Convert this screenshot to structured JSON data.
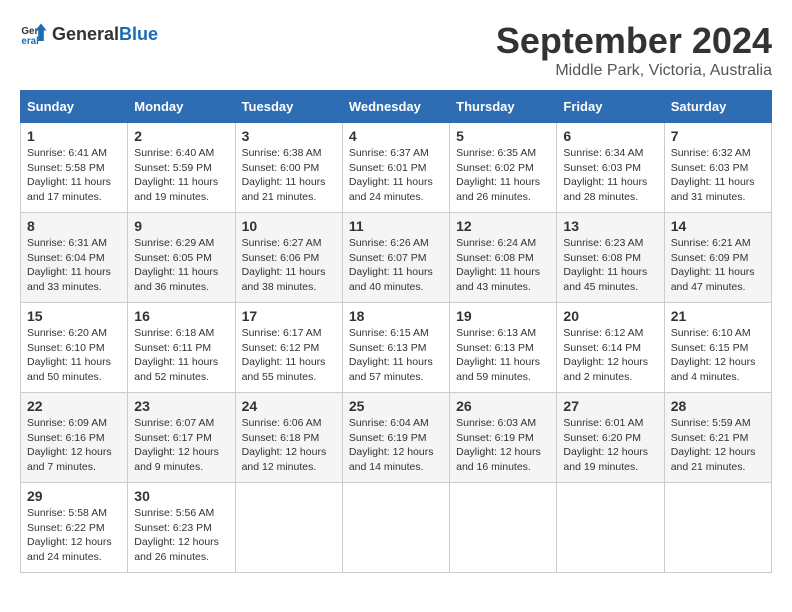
{
  "header": {
    "logo_general": "General",
    "logo_blue": "Blue",
    "title": "September 2024",
    "subtitle": "Middle Park, Victoria, Australia"
  },
  "calendar": {
    "columns": [
      "Sunday",
      "Monday",
      "Tuesday",
      "Wednesday",
      "Thursday",
      "Friday",
      "Saturday"
    ],
    "weeks": [
      [
        null,
        {
          "day": "2",
          "sunrise": "Sunrise: 6:40 AM",
          "sunset": "Sunset: 5:59 PM",
          "daylight": "Daylight: 11 hours and 19 minutes."
        },
        {
          "day": "3",
          "sunrise": "Sunrise: 6:38 AM",
          "sunset": "Sunset: 6:00 PM",
          "daylight": "Daylight: 11 hours and 21 minutes."
        },
        {
          "day": "4",
          "sunrise": "Sunrise: 6:37 AM",
          "sunset": "Sunset: 6:01 PM",
          "daylight": "Daylight: 11 hours and 24 minutes."
        },
        {
          "day": "5",
          "sunrise": "Sunrise: 6:35 AM",
          "sunset": "Sunset: 6:02 PM",
          "daylight": "Daylight: 11 hours and 26 minutes."
        },
        {
          "day": "6",
          "sunrise": "Sunrise: 6:34 AM",
          "sunset": "Sunset: 6:03 PM",
          "daylight": "Daylight: 11 hours and 28 minutes."
        },
        {
          "day": "7",
          "sunrise": "Sunrise: 6:32 AM",
          "sunset": "Sunset: 6:03 PM",
          "daylight": "Daylight: 11 hours and 31 minutes."
        }
      ],
      [
        {
          "day": "1",
          "sunrise": "Sunrise: 6:41 AM",
          "sunset": "Sunset: 5:58 PM",
          "daylight": "Daylight: 11 hours and 17 minutes."
        },
        null,
        null,
        null,
        null,
        null,
        null
      ],
      [
        {
          "day": "8",
          "sunrise": "Sunrise: 6:31 AM",
          "sunset": "Sunset: 6:04 PM",
          "daylight": "Daylight: 11 hours and 33 minutes."
        },
        {
          "day": "9",
          "sunrise": "Sunrise: 6:29 AM",
          "sunset": "Sunset: 6:05 PM",
          "daylight": "Daylight: 11 hours and 36 minutes."
        },
        {
          "day": "10",
          "sunrise": "Sunrise: 6:27 AM",
          "sunset": "Sunset: 6:06 PM",
          "daylight": "Daylight: 11 hours and 38 minutes."
        },
        {
          "day": "11",
          "sunrise": "Sunrise: 6:26 AM",
          "sunset": "Sunset: 6:07 PM",
          "daylight": "Daylight: 11 hours and 40 minutes."
        },
        {
          "day": "12",
          "sunrise": "Sunrise: 6:24 AM",
          "sunset": "Sunset: 6:08 PM",
          "daylight": "Daylight: 11 hours and 43 minutes."
        },
        {
          "day": "13",
          "sunrise": "Sunrise: 6:23 AM",
          "sunset": "Sunset: 6:08 PM",
          "daylight": "Daylight: 11 hours and 45 minutes."
        },
        {
          "day": "14",
          "sunrise": "Sunrise: 6:21 AM",
          "sunset": "Sunset: 6:09 PM",
          "daylight": "Daylight: 11 hours and 47 minutes."
        }
      ],
      [
        {
          "day": "15",
          "sunrise": "Sunrise: 6:20 AM",
          "sunset": "Sunset: 6:10 PM",
          "daylight": "Daylight: 11 hours and 50 minutes."
        },
        {
          "day": "16",
          "sunrise": "Sunrise: 6:18 AM",
          "sunset": "Sunset: 6:11 PM",
          "daylight": "Daylight: 11 hours and 52 minutes."
        },
        {
          "day": "17",
          "sunrise": "Sunrise: 6:17 AM",
          "sunset": "Sunset: 6:12 PM",
          "daylight": "Daylight: 11 hours and 55 minutes."
        },
        {
          "day": "18",
          "sunrise": "Sunrise: 6:15 AM",
          "sunset": "Sunset: 6:13 PM",
          "daylight": "Daylight: 11 hours and 57 minutes."
        },
        {
          "day": "19",
          "sunrise": "Sunrise: 6:13 AM",
          "sunset": "Sunset: 6:13 PM",
          "daylight": "Daylight: 11 hours and 59 minutes."
        },
        {
          "day": "20",
          "sunrise": "Sunrise: 6:12 AM",
          "sunset": "Sunset: 6:14 PM",
          "daylight": "Daylight: 12 hours and 2 minutes."
        },
        {
          "day": "21",
          "sunrise": "Sunrise: 6:10 AM",
          "sunset": "Sunset: 6:15 PM",
          "daylight": "Daylight: 12 hours and 4 minutes."
        }
      ],
      [
        {
          "day": "22",
          "sunrise": "Sunrise: 6:09 AM",
          "sunset": "Sunset: 6:16 PM",
          "daylight": "Daylight: 12 hours and 7 minutes."
        },
        {
          "day": "23",
          "sunrise": "Sunrise: 6:07 AM",
          "sunset": "Sunset: 6:17 PM",
          "daylight": "Daylight: 12 hours and 9 minutes."
        },
        {
          "day": "24",
          "sunrise": "Sunrise: 6:06 AM",
          "sunset": "Sunset: 6:18 PM",
          "daylight": "Daylight: 12 hours and 12 minutes."
        },
        {
          "day": "25",
          "sunrise": "Sunrise: 6:04 AM",
          "sunset": "Sunset: 6:19 PM",
          "daylight": "Daylight: 12 hours and 14 minutes."
        },
        {
          "day": "26",
          "sunrise": "Sunrise: 6:03 AM",
          "sunset": "Sunset: 6:19 PM",
          "daylight": "Daylight: 12 hours and 16 minutes."
        },
        {
          "day": "27",
          "sunrise": "Sunrise: 6:01 AM",
          "sunset": "Sunset: 6:20 PM",
          "daylight": "Daylight: 12 hours and 19 minutes."
        },
        {
          "day": "28",
          "sunrise": "Sunrise: 5:59 AM",
          "sunset": "Sunset: 6:21 PM",
          "daylight": "Daylight: 12 hours and 21 minutes."
        }
      ],
      [
        {
          "day": "29",
          "sunrise": "Sunrise: 5:58 AM",
          "sunset": "Sunset: 6:22 PM",
          "daylight": "Daylight: 12 hours and 24 minutes."
        },
        {
          "day": "30",
          "sunrise": "Sunrise: 5:56 AM",
          "sunset": "Sunset: 6:23 PM",
          "daylight": "Daylight: 12 hours and 26 minutes."
        },
        null,
        null,
        null,
        null,
        null
      ]
    ]
  }
}
